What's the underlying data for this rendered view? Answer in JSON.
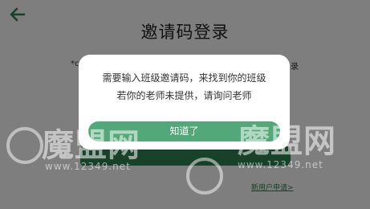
{
  "header": {
    "back_icon": "back-arrow-icon",
    "title": "邀请码登录"
  },
  "page": {
    "hint_left": "*c",
    "hint_right": "录",
    "new_user_link": "新用户申请>"
  },
  "dialog": {
    "line1": "需要输入班级邀请码，来找到你的班级",
    "line2": "若你的老师未提供，请询问老师",
    "ok_button": "知道了"
  },
  "watermarks": [
    {
      "brand": "魔盟网",
      "url": "www.12349.net"
    },
    {
      "brand": "魔盟网",
      "url": "www.12349.net"
    }
  ],
  "colors": {
    "accent_green": "#52a878",
    "dark_green": "#2e7d4f",
    "overlay": "rgba(0,0,0,0.48)"
  }
}
